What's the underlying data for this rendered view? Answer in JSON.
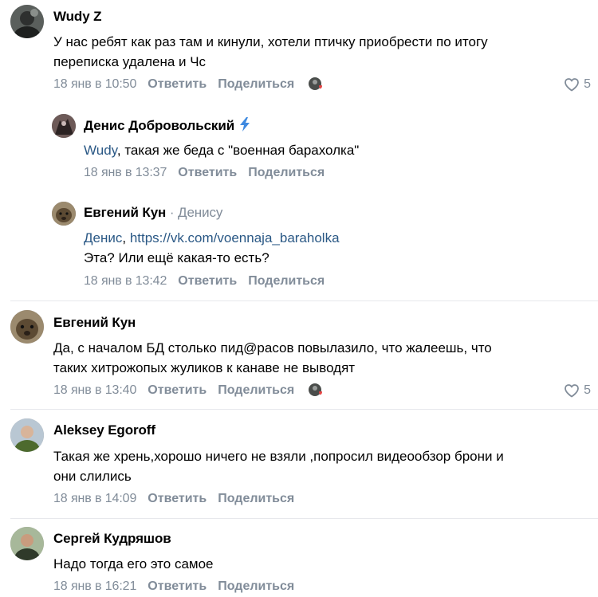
{
  "ui": {
    "reply_label": "Ответить",
    "share_label": "Поделиться",
    "accent_color": "#2a5885",
    "muted_color": "#818c99"
  },
  "comments": [
    {
      "author": "Wudy Z",
      "text_lines": [
        "У нас ребят как раз там и кинули, хотели птичку приобрести по итогу",
        "переписка удалена и Чс"
      ],
      "date": "18 янв в 10:50",
      "likes": "5",
      "replies": [
        {
          "author": "Денис Добровольский",
          "mention": "Wudy",
          "text_rest": ", такая же беда с \"военная барахолка\"",
          "date": "18 янв в 13:37"
        },
        {
          "author": "Евгений Кун",
          "reply_to": "Денису",
          "mention": "Денис",
          "link_sep": ", ",
          "link": "https://vk.com/voennaja_baraholka",
          "text_line2": "Эта? Или ещё какая-то есть?",
          "date": "18 янв в 13:42"
        }
      ]
    },
    {
      "author": "Евгений Кун",
      "text_lines": [
        "Да, с началом БД столько пид@расов повылазило, что жалеешь, что",
        "таких хитрожопых жуликов к канаве не выводят"
      ],
      "date": "18 янв в 13:40",
      "likes": "5"
    },
    {
      "author": "Aleksey Egoroff",
      "text_lines": [
        "Такая же хрень,хорошо ничего не взяли ,попросил видеообзор брони и",
        "они слились"
      ],
      "date": "18 янв в 14:09"
    },
    {
      "author": "Сергей Кудряшов",
      "text_lines": [
        "Надо тогда его это самое"
      ],
      "date": "18 янв в 16:21"
    }
  ]
}
